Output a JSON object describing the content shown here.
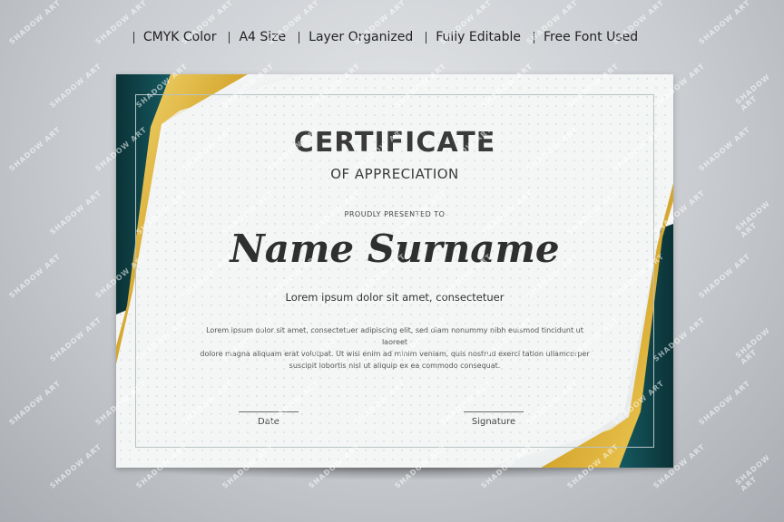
{
  "features": [
    "CMYK Color",
    "A4 Size",
    "Layer Organized",
    "Fully Editable",
    "Free Font Used"
  ],
  "certificate": {
    "title": "CERTIFICATE",
    "subtitle": "OF APPRECIATION",
    "presented_to": "PROUDLY PRESENTED TO",
    "recipient_name": "Name Surname",
    "tagline": "Lorem ipsum dolor sit amet, consectetuer",
    "body_lines": [
      "Lorem ipsum dolor sit amet, consectetuer adipiscing elit, sed diam nonummy nibh euismod tincidunt ut laoreet",
      "dolore magna aliquam erat volutpat. Ut wisi enim ad minim veniam, quis nostrud exerci tation ullamcorper",
      "suscipit lobortis nisl ut aliquip ex ea commodo consequat."
    ],
    "date_label": "Date",
    "signature_label": "Signature"
  },
  "watermark_text": "SHADOW ART",
  "colors": {
    "teal_dark": "#0d3b40",
    "teal": "#125259",
    "gold_light": "#f5d56a",
    "gold_dark": "#b8861b",
    "paper": "#f4f6f6"
  }
}
